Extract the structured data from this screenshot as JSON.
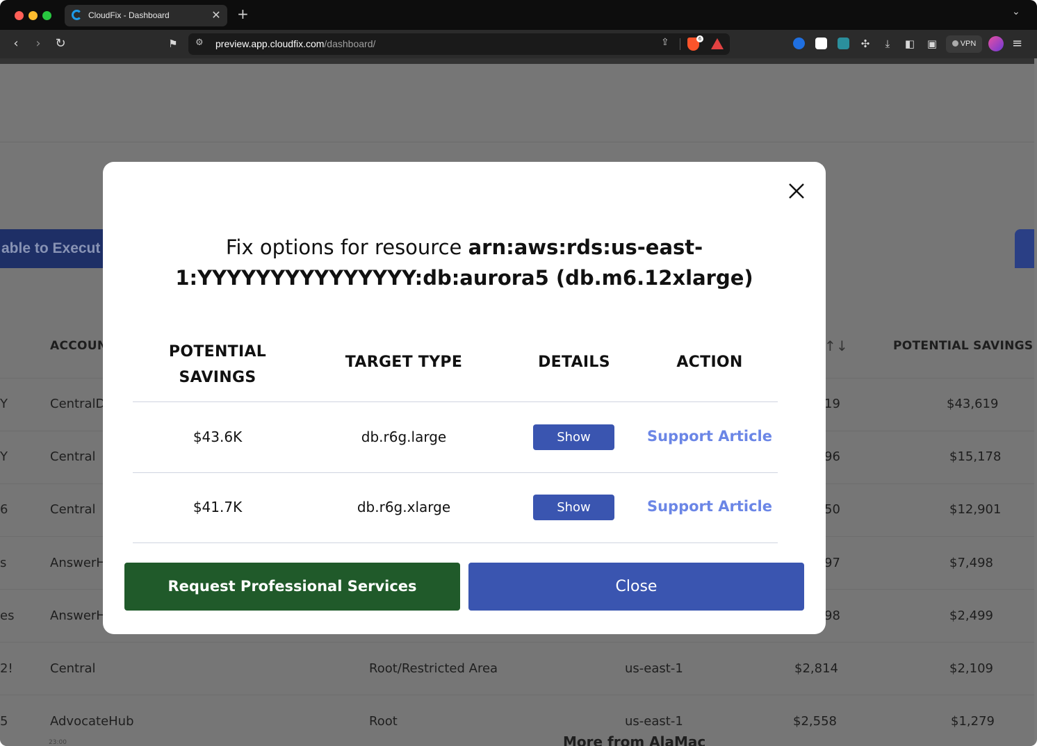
{
  "browser": {
    "tab_title": "CloudFix - Dashboard",
    "tab_close": "✕",
    "new_tab": "+",
    "url_host": "preview.app.cloudfix.com",
    "url_path": "/dashboard/",
    "brave_badge": "6",
    "vpn_label": "VPN"
  },
  "background": {
    "banner_fragment": "able to Execut",
    "headers": {
      "account": "ACCOUN",
      "sort_arrows": "↑↓",
      "potential_savings": "POTENTIAL SAVINGS ↑"
    },
    "rows": [
      {
        "lead": "Y",
        "account": "CentralD",
        "mid": "",
        "region": "",
        "cost": "19",
        "savings": "$43,619"
      },
      {
        "lead": "Y",
        "account": "Central",
        "mid": "",
        "region": "",
        "cost": "96",
        "savings": "$15,178"
      },
      {
        "lead": "6",
        "account": "Central",
        "mid": "",
        "region": "",
        "cost": "50",
        "savings": "$12,901"
      },
      {
        "lead": "s",
        "account": "AnswerH",
        "mid": "",
        "region": "",
        "cost": "97",
        "savings": "$7,498"
      },
      {
        "lead": "es",
        "account": "AnswerH",
        "mid": "",
        "region": "",
        "cost": "98",
        "savings": "$2,499"
      },
      {
        "lead": "2!",
        "account": "Central",
        "mid": "Root/Restricted Area",
        "region": "us-east-1",
        "cost": "$2,814",
        "savings": "$2,109"
      },
      {
        "lead": "5",
        "account": "AdvocateHub",
        "mid": "Root",
        "region": "us-east-1",
        "cost": "$2,558",
        "savings": "$1,279"
      }
    ],
    "bottom_fragment": "More from AlaMac",
    "bottom_small": "23:00"
  },
  "modal": {
    "title_prefix": "Fix options for resource ",
    "title_line1_bold": "arn:aws:rds:us-east-",
    "title_line2_bold": "1:YYYYYYYYYYYYYYY:db:aurora5 (db.m6.12xlarge)",
    "columns": {
      "savings_line1": "POTENTIAL",
      "savings_line2": "SAVINGS",
      "target": "TARGET TYPE",
      "details": "DETAILS",
      "action": "ACTION"
    },
    "rows": [
      {
        "savings": "$43.6K",
        "target": "db.r6g.large",
        "details_button": "Show",
        "action_link": "Support Article"
      },
      {
        "savings": "$41.7K",
        "target": "db.r6g.xlarge",
        "details_button": "Show",
        "action_link": "Support Article"
      }
    ],
    "request_button": "Request Professional Services",
    "close_button": "Close"
  }
}
